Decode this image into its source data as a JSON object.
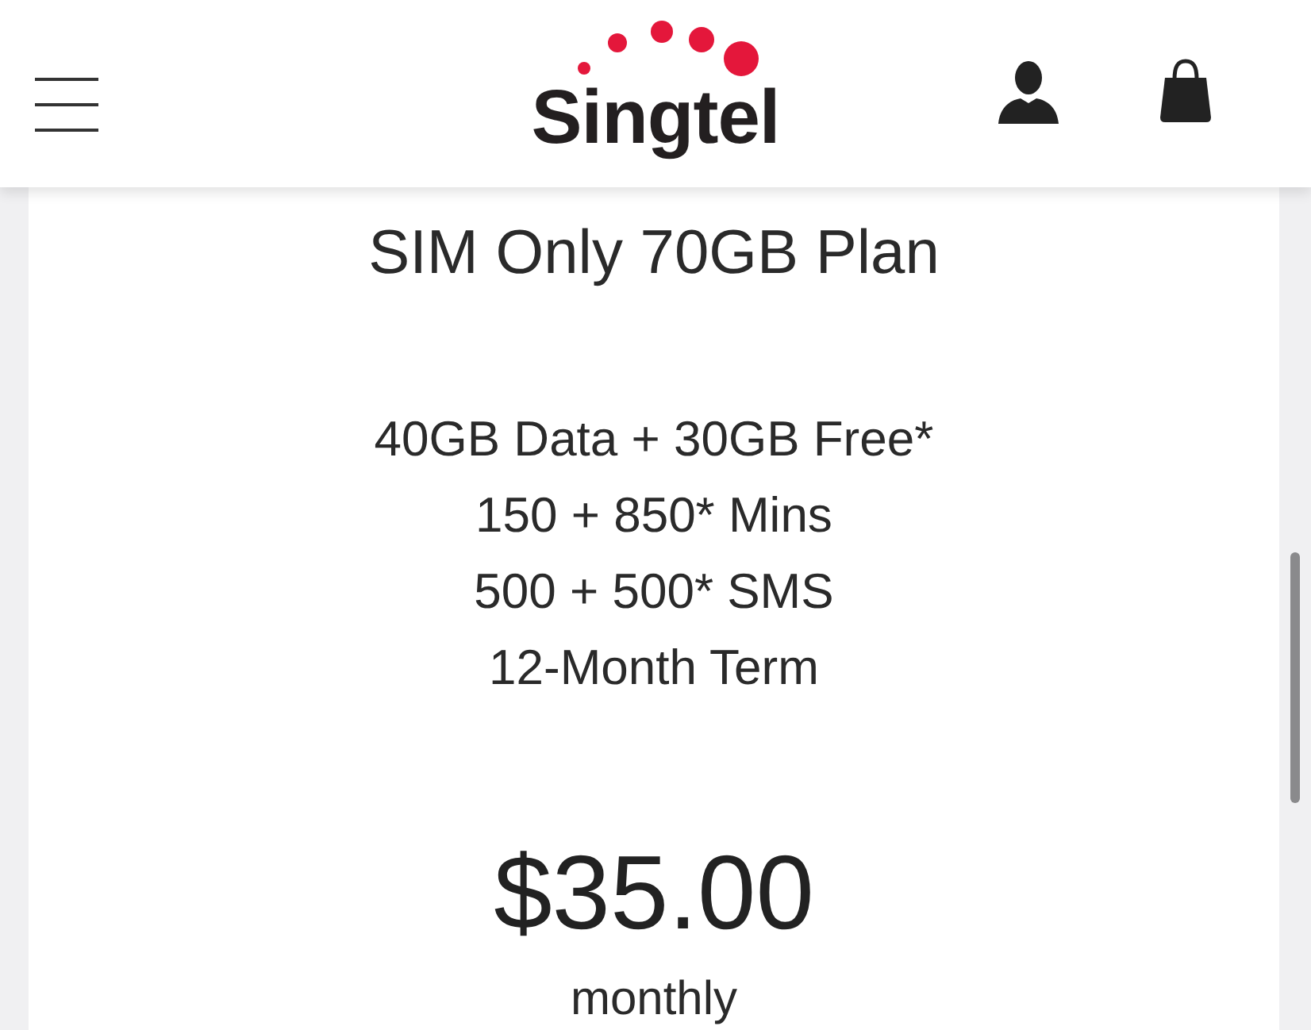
{
  "header": {
    "logo": {
      "text": "Singtel"
    }
  },
  "plan": {
    "title": "SIM Only 70GB Plan",
    "features": [
      "40GB Data + 30GB Free*",
      "150 + 850* Mins",
      "500 + 500* SMS",
      "12-Month Term"
    ],
    "price": "$35.00",
    "period": "monthly"
  }
}
